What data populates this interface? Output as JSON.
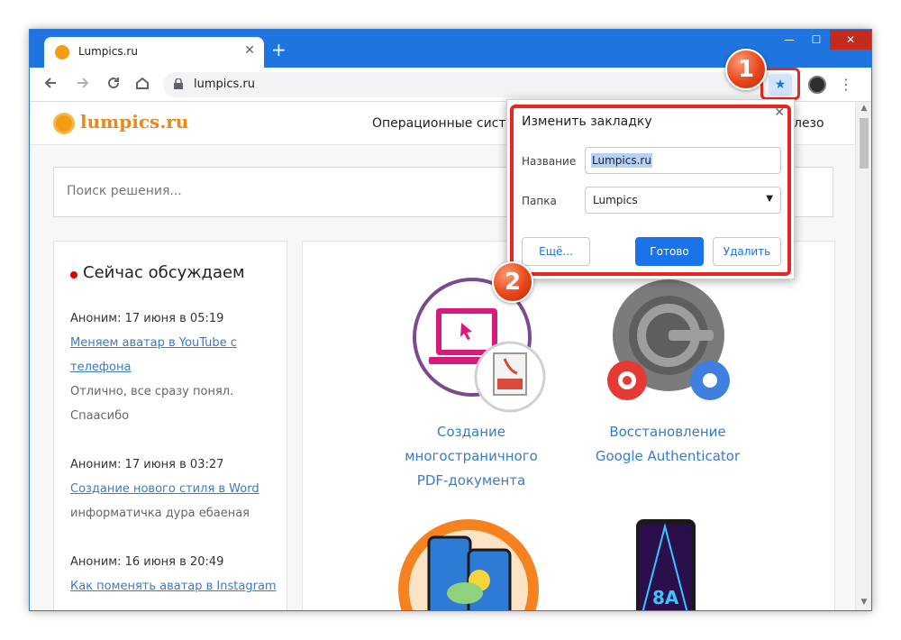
{
  "browser": {
    "tab_title": "Lumpics.ru",
    "tab_close": "✕",
    "new_tab": "+",
    "url": "lumpics.ru",
    "window_min": "—",
    "window_max": "☐",
    "window_close": "✕"
  },
  "site": {
    "logo": "lumpics.ru",
    "nav_left": "Операционные систе",
    "nav_right": "лезо",
    "search_placeholder": "Поиск решения..."
  },
  "sidebar": {
    "title": "Сейчас обсуждаем",
    "comments": [
      {
        "meta": "Аноним: 17 июня в 05:19",
        "link_line1": "Меняем аватар в YouTube с",
        "link_line2": "телефона",
        "text_line1": "Отлично, все сразу понял.",
        "text_line2": "Спаасибо"
      },
      {
        "meta": "Аноним: 17 июня в 03:27",
        "link_line1": "Создание нового стиля в Word",
        "text_line1": "информатичка дура ебаеная"
      },
      {
        "meta": "Аноним: 16 июня в 20:49",
        "link_line1": "Как поменять аватар в Instagram"
      }
    ]
  },
  "articles": [
    {
      "line1": "Создание",
      "line2": "многостраничного",
      "line3": "PDF-документа"
    },
    {
      "line1": "Восстановление",
      "line2": "Google Authenticator"
    }
  ],
  "popup": {
    "title": "Изменить закладку",
    "name_label": "Название",
    "name_value": "Lumpics.ru",
    "folder_label": "Папка",
    "folder_value": "Lumpics",
    "more_button": "Ещё...",
    "done_button": "Готово",
    "delete_button": "Удалить",
    "close": "✕"
  },
  "badges": {
    "one": "1",
    "two": "2"
  },
  "colors": {
    "accent": "#1a73e8",
    "highlight": "#e8261f",
    "brand_orange": "#e8891a",
    "link": "#3a7ac9"
  }
}
